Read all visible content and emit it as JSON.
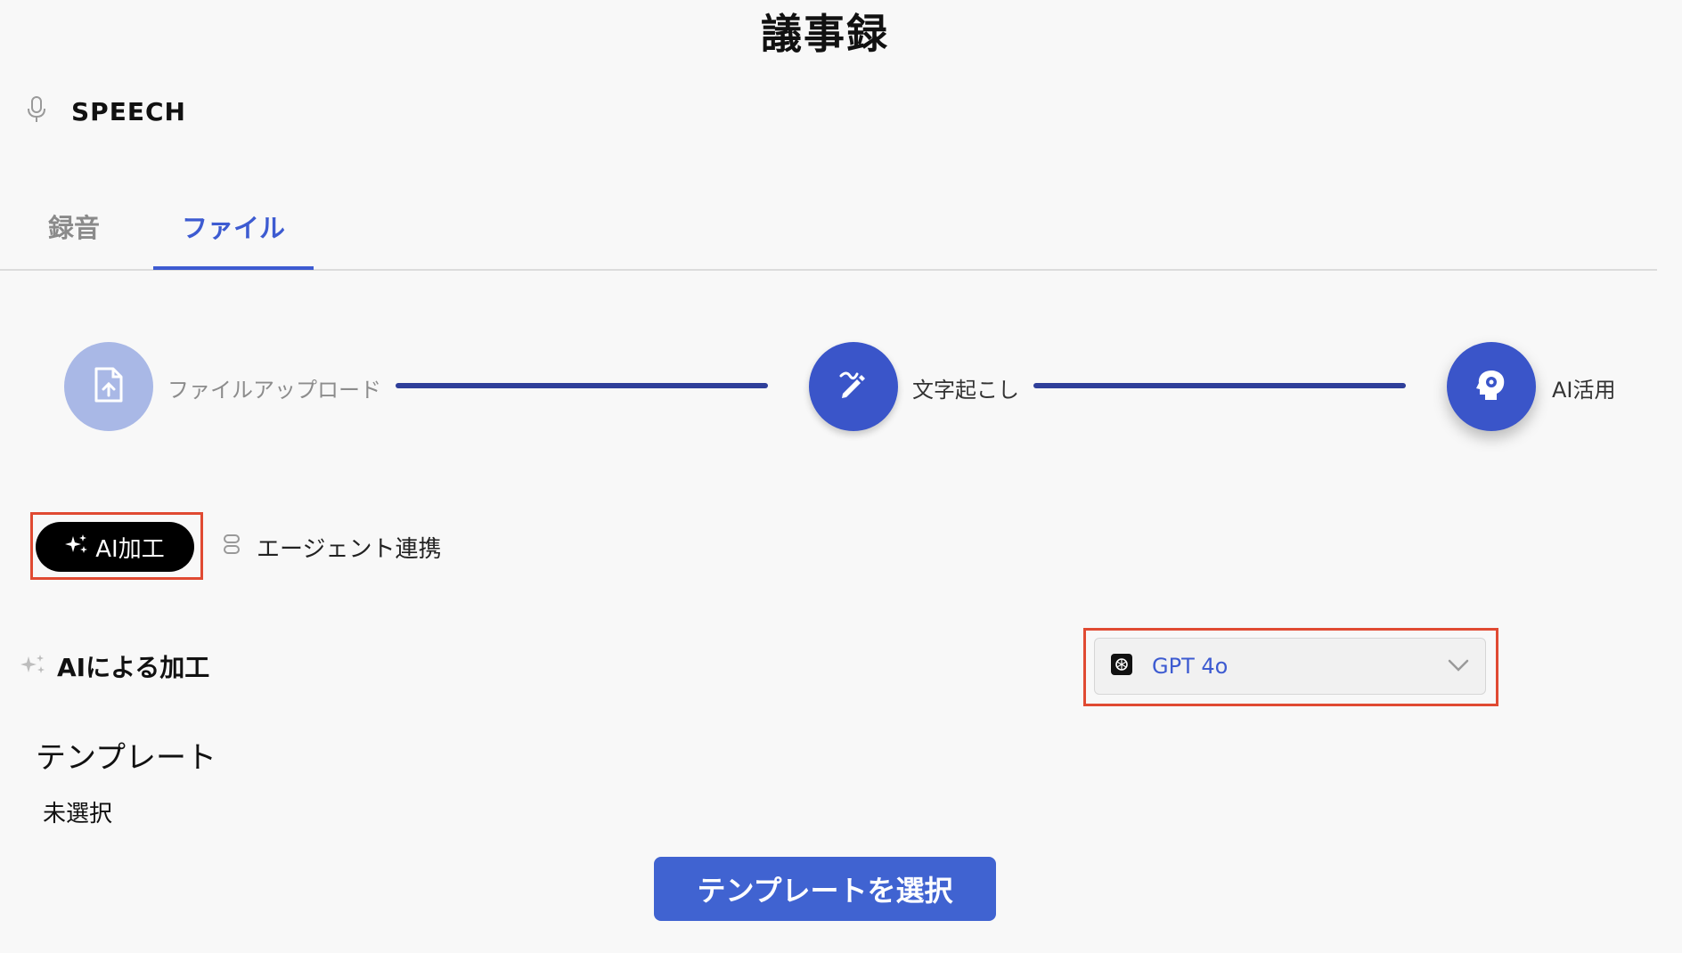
{
  "page": {
    "title": "議事録"
  },
  "speech": {
    "label": "SPEECH"
  },
  "tabs": [
    {
      "label": "録音",
      "active": false
    },
    {
      "label": "ファイル",
      "active": true
    }
  ],
  "steps": [
    {
      "label": "ファイルアップロード",
      "icon": "file-upload-icon",
      "state": "done"
    },
    {
      "label": "文字起こし",
      "icon": "pen-edit-icon",
      "state": "done"
    },
    {
      "label": "AI活用",
      "icon": "ai-head-gear-icon",
      "state": "current"
    }
  ],
  "mode_tabs": {
    "ai_processing": "AI加工",
    "agent_integration": "エージェント連携"
  },
  "section": {
    "title": "AIによる加工"
  },
  "model_select": {
    "value": "GPT 4o",
    "icon": "openai-icon"
  },
  "template": {
    "label": "テンプレート",
    "value": "未選択",
    "button_label": "テンプレートを選択"
  },
  "colors": {
    "accent": "#3d5bd1",
    "step_done_light": "#a9b8e6",
    "step_active": "#3a55c9",
    "highlight": "#e04a32",
    "primary_button": "#4063d1"
  }
}
